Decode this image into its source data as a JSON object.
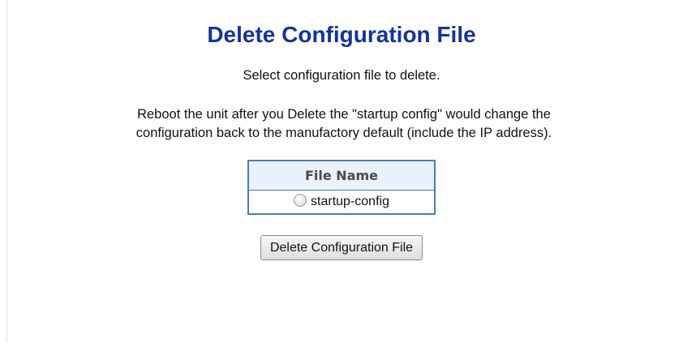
{
  "page": {
    "title": "Delete Configuration File",
    "instruction": "Select configuration file to delete.",
    "warning_line1": "Reboot the unit after you Delete the \"startup config\" would change the",
    "warning_line2": "configuration back to the manufactory default (include the IP address)."
  },
  "file_table": {
    "header": "File Name",
    "rows": [
      {
        "name": "startup-config",
        "selected": false
      }
    ]
  },
  "actions": {
    "delete_label": "Delete Configuration File"
  }
}
